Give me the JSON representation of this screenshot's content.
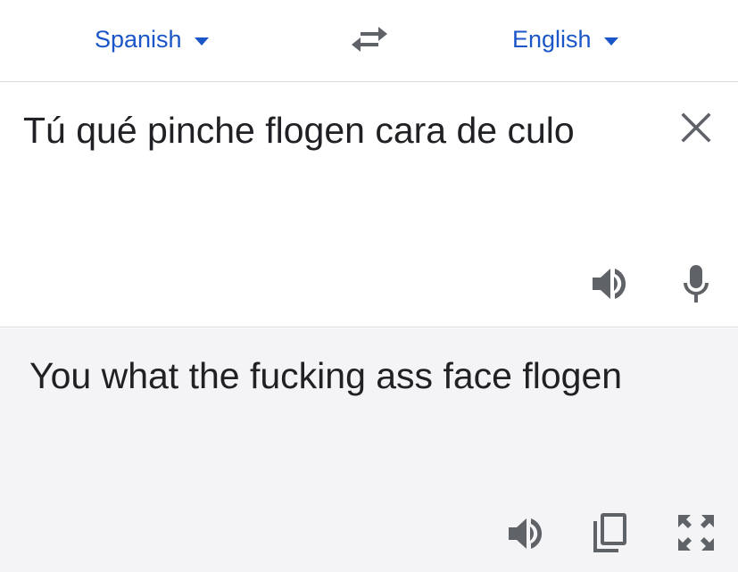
{
  "languages": {
    "source": "Spanish",
    "target": "English"
  },
  "source": {
    "text": "Tú qué pinche flogen cara de culo"
  },
  "target": {
    "text": "You what the fucking ass face flogen"
  },
  "icons": {
    "swap": "swap-arrows-icon",
    "clear": "close-icon",
    "source_speak": "speaker-icon",
    "source_mic": "microphone-icon",
    "target_speak": "speaker-icon",
    "target_copy": "copy-icon",
    "target_expand": "fullscreen-icon"
  },
  "colors": {
    "accent": "#1a56c8",
    "icon": "#5f6368",
    "target_background": "#f4f4f7"
  }
}
